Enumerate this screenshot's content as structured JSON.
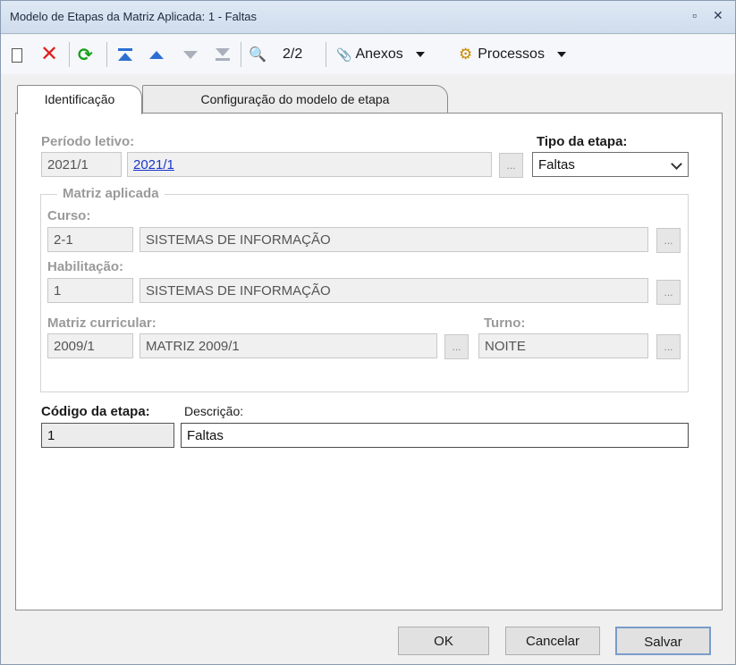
{
  "window": {
    "title": "Modelo de Etapas da Matriz Aplicada: 1 - Faltas",
    "restore_glyph": "▫",
    "close_glyph": "✕"
  },
  "toolbar": {
    "counter": "2/2",
    "anexos_label": "Anexos",
    "processos_label": "Processos",
    "search_glyph": "🔍",
    "clip_glyph": "📎",
    "gear_glyph": "⚙",
    "refresh_glyph": "⟳",
    "delete_glyph": "✕"
  },
  "tabs": [
    {
      "label": "Identificação",
      "active": true
    },
    {
      "label": "Configuração do modelo de etapa",
      "active": false
    }
  ],
  "form": {
    "periodo": {
      "label": "Período letivo:",
      "code": "2021/1",
      "description": "2021/1"
    },
    "tipo": {
      "label": "Tipo da etapa:",
      "value": "Faltas"
    },
    "matriz_group_title": "Matriz aplicada",
    "curso": {
      "label": "Curso:",
      "code": "2-1",
      "description": "SISTEMAS DE INFORMAÇÃO"
    },
    "habilitacao": {
      "label": "Habilitação:",
      "code": "1",
      "description": "SISTEMAS DE INFORMAÇÃO"
    },
    "matriz": {
      "label": "Matriz curricular:",
      "code": "2009/1",
      "description": "MATRIZ 2009/1"
    },
    "turno": {
      "label": "Turno:",
      "value": "NOITE"
    },
    "codigo": {
      "label": "Código da etapa:",
      "value": "1"
    },
    "descricao": {
      "label": "Descrição:",
      "value": "Faltas"
    },
    "ellipsis": "..."
  },
  "buttons": {
    "ok": "OK",
    "cancelar": "Cancelar",
    "salvar": "Salvar"
  }
}
